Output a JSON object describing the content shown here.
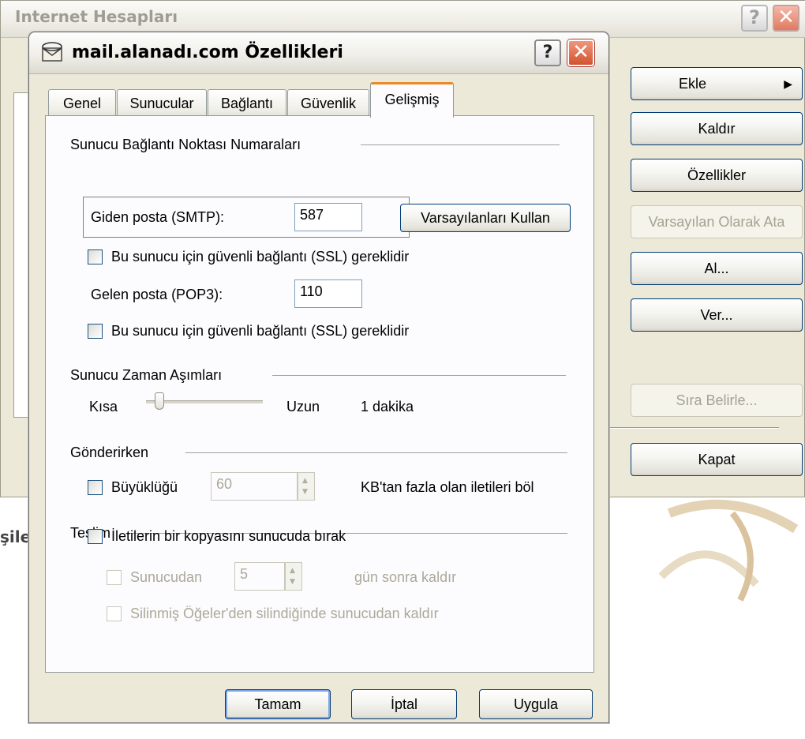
{
  "background_window": {
    "title": "Internet Hesapları",
    "buttons": {
      "add": "Ekle",
      "remove": "Kaldır",
      "properties": "Özellikler",
      "set_default": "Varsayılan Olarak Ata",
      "import": "Al...",
      "export": "Ver...",
      "set_order": "Sıra Belirle...",
      "close": "Kapat"
    },
    "cut_text": "şile"
  },
  "dialog": {
    "title": "mail.alanadı.com Özellikleri",
    "tabs": [
      "Genel",
      "Sunucular",
      "Bağlantı",
      "Güvenlik",
      "Gelişmiş"
    ],
    "active_tab": "Gelişmiş",
    "ports": {
      "heading": "Sunucu Bağlantı Noktası Numaraları",
      "smtp_label": "Giden posta (SMTP):",
      "smtp_value": "587",
      "use_defaults": "Varsayılanları Kullan",
      "smtp_ssl_label": "Bu sunucu için güvenli bağlantı (SSL) gereklidir",
      "pop3_label": "Gelen posta (POP3):",
      "pop3_value": "110",
      "pop3_ssl_label": "Bu sunucu için güvenli bağlantı (SSL) gereklidir"
    },
    "timeouts": {
      "heading": "Sunucu Zaman Aşımları",
      "short": "Kısa",
      "long": "Uzun",
      "value": "1 dakika",
      "slider_fraction": 0.08
    },
    "sending": {
      "heading": "Gönderirken",
      "size_label": "Büyüklüğü",
      "size_value": "60",
      "size_suffix": "KB'tan fazla olan iletileri böl"
    },
    "delivery": {
      "heading": "Teslim",
      "leave_copy_label": "İletilerin bir kopyasını sunucuda bırak",
      "remove_after_label": "Sunucudan",
      "remove_after_value": "5",
      "remove_after_suffix": "gün sonra kaldır",
      "remove_deleted_label": "Silinmiş Öğeler'den silindiğinde sunucudan kaldır"
    },
    "buttons": {
      "ok": "Tamam",
      "cancel": "İptal",
      "apply": "Uygula"
    }
  },
  "colors": {
    "accent_tab": "#e68b2c",
    "arrow": "#e01010",
    "button_border": "#003c74"
  }
}
